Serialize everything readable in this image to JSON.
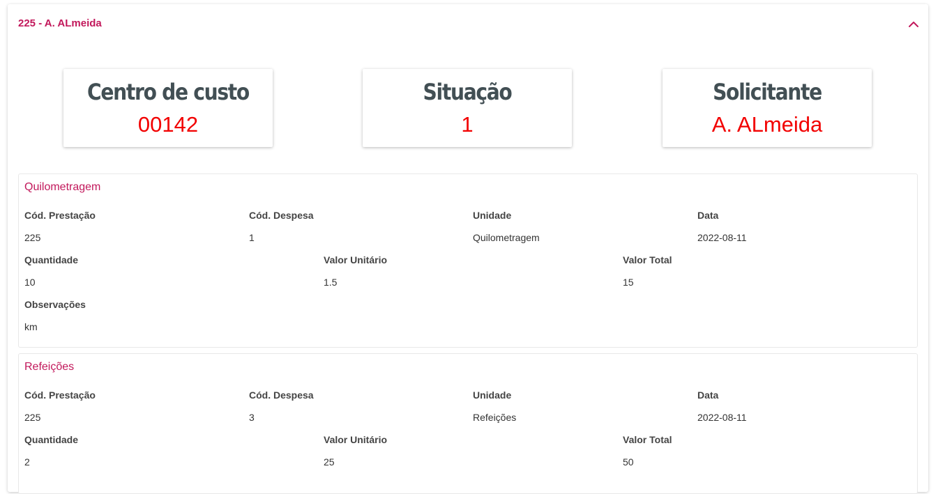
{
  "header": {
    "title": "225 - A. ALmeida",
    "collapse_icon": "chevron-up-icon",
    "accent_color": "#c2185b"
  },
  "summary": {
    "cost_center": {
      "label": "Centro de custo",
      "value": "00142"
    },
    "status": {
      "label": "Situação",
      "value": "1"
    },
    "requester": {
      "label": "Solicitante",
      "value": "A. ALmeida"
    },
    "value_color": "#f20000"
  },
  "expenses": [
    {
      "title": "Quilometragem",
      "labels": {
        "cod_prestacao": "Cód. Prestação",
        "cod_despesa": "Cód. Despesa",
        "unidade": "Unidade",
        "data": "Data",
        "quantidade": "Quantidade",
        "valor_unitario": "Valor Unitário",
        "valor_total": "Valor Total",
        "observacoes": "Observações"
      },
      "values": {
        "cod_prestacao": "225",
        "cod_despesa": "1",
        "unidade": "Quilometragem",
        "data": "2022-08-11",
        "quantidade": "10",
        "valor_unitario": "1.5",
        "valor_total": "15",
        "observacoes": "km"
      }
    },
    {
      "title": "Refeições",
      "labels": {
        "cod_prestacao": "Cód. Prestação",
        "cod_despesa": "Cód. Despesa",
        "unidade": "Unidade",
        "data": "Data",
        "quantidade": "Quantidade",
        "valor_unitario": "Valor Unitário",
        "valor_total": "Valor Total"
      },
      "values": {
        "cod_prestacao": "225",
        "cod_despesa": "3",
        "unidade": "Refeições",
        "data": "2022-08-11",
        "quantidade": "2",
        "valor_unitario": "25",
        "valor_total": "50"
      }
    }
  ]
}
